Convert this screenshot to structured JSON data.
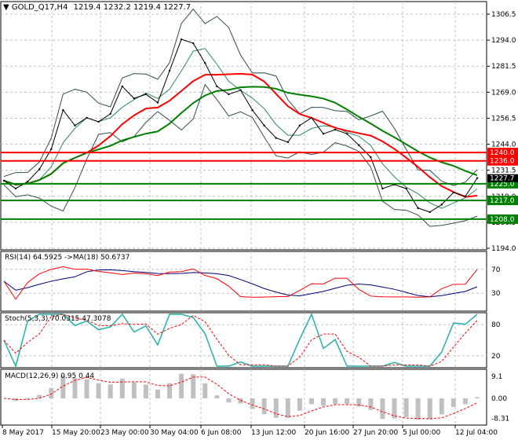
{
  "header": {
    "symbol": "GOLD_Q17,H4",
    "ohlc": "1219.4 1232.2 1219.4 1227.7"
  },
  "rsi": {
    "label": "RSI(14) 64.5925  ->MA(18) 50.6737",
    "levels": [
      "70",
      "30"
    ]
  },
  "stoch": {
    "label": "Stoch(5,3,3) 70.0315 47.3078",
    "levels": [
      "80",
      "20"
    ]
  },
  "macd": {
    "label": "MACD(12,26,9) 0.95 0.44",
    "levels": [
      "9.1",
      "0.00",
      "-8.31"
    ]
  },
  "chart_data": {
    "type": "line",
    "x_ticks": [
      "8 May 2017",
      "15 May 20:00",
      "23 May 00:00",
      "30 May 04:00",
      "6 Jun 08:00",
      "13 Jun 12:00",
      "20 Jun 16:00",
      "27 Jun 20:00",
      "5 Jul 00:00",
      "12 Jul 04:00"
    ],
    "y_ticks": [
      "1306.5",
      "1294.0",
      "1281.5",
      "1269.0",
      "1256.5",
      "1244.0",
      "1231.5",
      "1219.0",
      "1206.5",
      "1194.0"
    ],
    "ylim": [
      1194.0,
      1306.5
    ],
    "grid": true,
    "close": [
      1226.5,
      1222.7,
      1226,
      1232,
      1241.6,
      1260.4,
      1253,
      1256.7,
      1254.8,
      1258.6,
      1271.8,
      1266,
      1268,
      1264,
      1279.3,
      1294.4,
      1292.5,
      1283,
      1271.8,
      1268,
      1270,
      1260.4,
      1253,
      1247,
      1245,
      1253,
      1256.7,
      1249,
      1251,
      1249,
      1243.5,
      1237.8,
      1222.7,
      1224.6,
      1222.7,
      1213.3,
      1211.4,
      1215,
      1220.8,
      1219,
      1227.7
    ],
    "current_price": "1227.7",
    "levels": [
      {
        "value": "1240.0",
        "color": "#ff0000"
      },
      {
        "value": "1236.0",
        "color": "#ff0000"
      },
      {
        "value": "1225.0",
        "color": "#008000"
      },
      {
        "value": "1217.0",
        "color": "#008000"
      },
      {
        "value": "1208.0",
        "color": "#008000"
      }
    ],
    "colors": {
      "price": "#000000",
      "ma_fast": "#ff0000",
      "ma_slow": "#008000",
      "bands": "#2f4f4f",
      "rsi": "#ff0000",
      "rsi_ma": "#000080",
      "stoch_main": "#20b2aa",
      "stoch_signal": "#ff0000",
      "macd_hist": "#c0c0c0",
      "macd_signal": "#ff0000"
    }
  }
}
